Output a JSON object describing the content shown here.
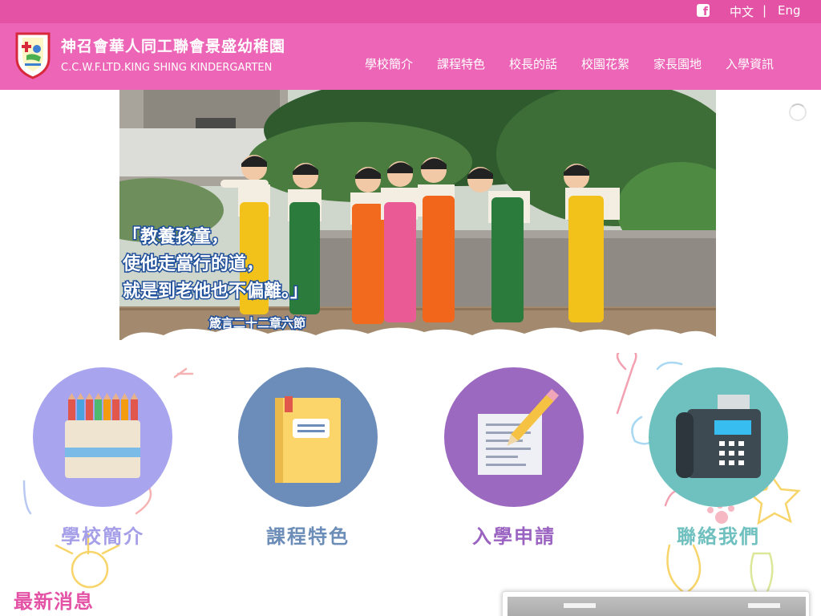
{
  "topbar": {
    "facebook_icon": "facebook-icon",
    "lang_zh": "中文",
    "lang_sep": "|",
    "lang_en": "Eng"
  },
  "header": {
    "name_zh": "神召會華人同工聯會景盛幼稚園",
    "name_en": "C.C.W.F.LTD.KING SHING KINDERGARTEN",
    "nav": [
      "學校簡介",
      "課程特色",
      "校長的話",
      "校園花絮",
      "家長園地",
      "入學資訊"
    ]
  },
  "hero": {
    "quote_line1": "「教養孩童，",
    "quote_line2": "使他走當行的道，",
    "quote_line3": "就是到老他也不偏離。」",
    "quote_source": "箴言二十二章六節"
  },
  "features": [
    {
      "label": "學校簡介",
      "color": "#a8a5ee",
      "label_color": "#a59ee8",
      "icon": "crayon-box-icon"
    },
    {
      "label": "課程特色",
      "color": "#6c8dba",
      "label_color": "#6b8db7",
      "icon": "notebook-icon"
    },
    {
      "label": "入學申請",
      "color": "#9b69c0",
      "label_color": "#9a63c1",
      "icon": "form-pencil-icon"
    },
    {
      "label": "聯絡我們",
      "color": "#6fc1c0",
      "label_color": "#6fc0bf",
      "icon": "fax-phone-icon"
    }
  ],
  "news": {
    "title": "最新消息"
  },
  "colors": {
    "topbar": "#e452a6",
    "header": "#ec65b6",
    "accent": "#e452a6"
  }
}
